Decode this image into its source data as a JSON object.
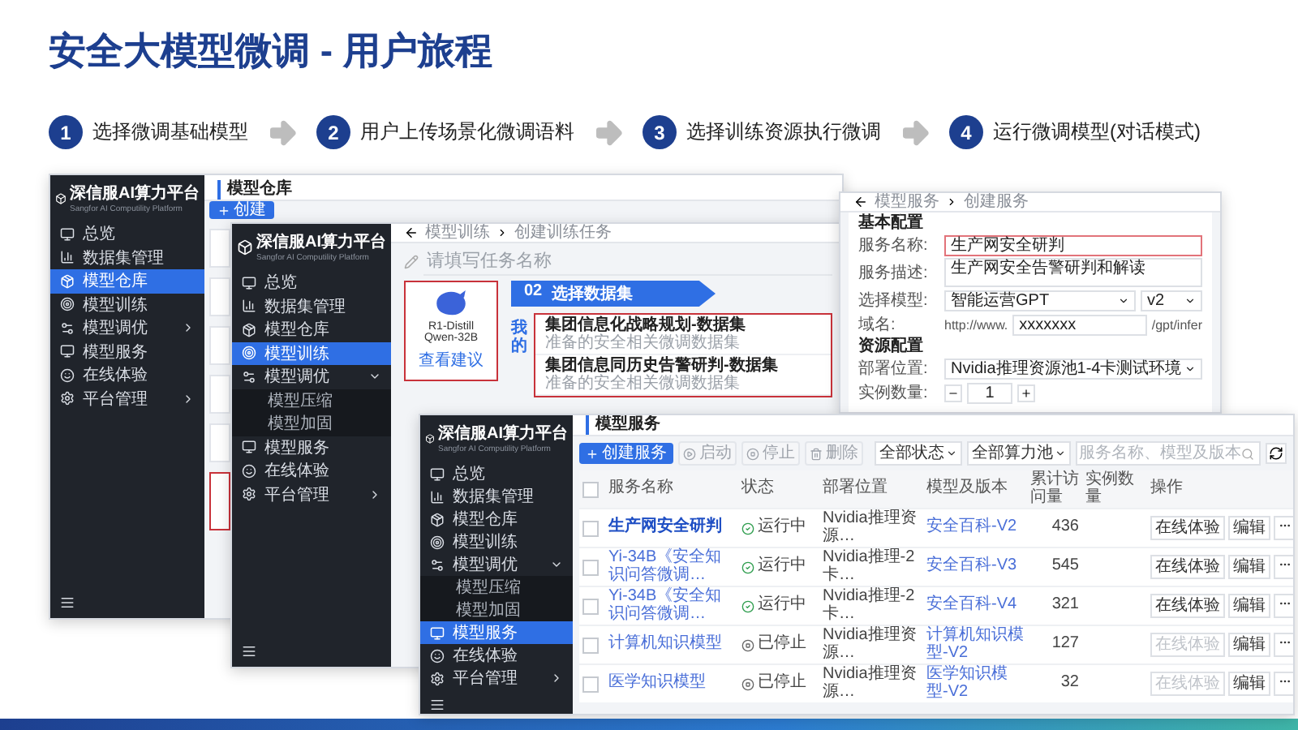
{
  "title": "安全大模型微调 - 用户旅程",
  "steps": [
    {
      "number": "1",
      "label": "选择微调基础模型"
    },
    {
      "number": "2",
      "label": "用户上传场景化微调语料"
    },
    {
      "number": "3",
      "label": "选择训练资源执行微调"
    },
    {
      "number": "4",
      "label": "运行微调模型(对话模式)"
    }
  ],
  "model_repo_window": {
    "sidebar": {
      "brand": "深信服AI算力平台",
      "subtitle": "Sangfor AI Computility Platform",
      "items": [
        {
          "kind": "link",
          "label": "总览",
          "selected": false
        },
        {
          "kind": "link",
          "label": "数据集管理",
          "selected": false
        },
        {
          "kind": "link",
          "label": "模型仓库",
          "selected": true
        },
        {
          "kind": "link",
          "label": "模型训练",
          "selected": false
        },
        {
          "kind": "group",
          "label": "模型调优",
          "selected": false,
          "expanded": false
        },
        {
          "kind": "link",
          "label": "模型服务",
          "selected": false
        },
        {
          "kind": "link",
          "label": "在线体验",
          "selected": false
        },
        {
          "kind": "group",
          "label": "平台管理",
          "selected": false,
          "expanded": false
        }
      ]
    },
    "page_title": "模型仓库",
    "create_button": "创建",
    "card_highlighted": true
  },
  "training_window": {
    "sidebar": {
      "brand": "深信服AI算力平台",
      "subtitle": "Sangfor AI Computility Platform",
      "items": [
        {
          "kind": "link",
          "label": "总览",
          "selected": false
        },
        {
          "kind": "link",
          "label": "数据集管理",
          "selected": false
        },
        {
          "kind": "link",
          "label": "模型仓库",
          "selected": false
        },
        {
          "kind": "link",
          "label": "模型训练",
          "selected": true
        },
        {
          "kind": "group",
          "label": "模型调优",
          "selected": false,
          "expanded": true,
          "children": [
            {
              "label": "模型压缩",
              "selected": false
            },
            {
              "label": "模型加固",
              "selected": false
            }
          ]
        },
        {
          "kind": "link",
          "label": "模型服务",
          "selected": false
        },
        {
          "kind": "link",
          "label": "在线体验",
          "selected": false
        },
        {
          "kind": "group",
          "label": "平台管理",
          "selected": false,
          "expanded": false
        }
      ]
    },
    "breadcrumb": [
      "模型训练",
      "创建训练任务"
    ],
    "task_name_placeholder": "请填写任务名称",
    "step_banner": {
      "number": "02",
      "label": "选择数据集"
    },
    "model_card": {
      "name": "R1-Distill Qwen-32B",
      "link": "查看建议",
      "highlighted": true
    },
    "dataset_tab": "我的",
    "datasets_highlighted": true,
    "datasets": [
      {
        "name": "集团信息化战略规划-数据集",
        "description": "准备的安全相关微调数据集"
      },
      {
        "name": "集团信息同历史告警研判-数据集",
        "description": "准备的安全相关微调数据集"
      }
    ]
  },
  "service_form_window": {
    "breadcrumb": [
      "模型服务",
      "创建服务"
    ],
    "sections": [
      {
        "title": "基本配置",
        "fields": [
          {
            "kind": "input",
            "label": "服务名称:",
            "value": "生产网安全研判",
            "highlighted": true
          },
          {
            "kind": "textarea",
            "label": "服务描述:",
            "value": "生产网安全告警研判和解读",
            "highlighted": false
          },
          {
            "kind": "select",
            "label": "选择模型:",
            "value": "智能运营GPT",
            "version": "v2",
            "highlighted": false
          },
          {
            "kind": "domain",
            "label": "域名:",
            "prefix": "http://www.",
            "value": "xxxxxxx",
            "suffix": "/gpt/infer",
            "highlighted": false
          }
        ]
      },
      {
        "title": "资源配置",
        "fields": [
          {
            "kind": "select",
            "label": "部署位置:",
            "value": "Nvidia推理资源池1-4卡测试环境",
            "highlighted": false
          },
          {
            "kind": "stepper",
            "label": "实例数量:",
            "value": "1",
            "highlighted": false
          }
        ]
      }
    ]
  },
  "services_window": {
    "sidebar": {
      "brand": "深信服AI算力平台",
      "subtitle": "Sangfor AI Computility Platform",
      "items": [
        {
          "kind": "link",
          "label": "总览",
          "selected": false
        },
        {
          "kind": "link",
          "label": "数据集管理",
          "selected": false
        },
        {
          "kind": "link",
          "label": "模型仓库",
          "selected": false
        },
        {
          "kind": "link",
          "label": "模型训练",
          "selected": false
        },
        {
          "kind": "group",
          "label": "模型调优",
          "selected": false,
          "expanded": true,
          "children": [
            {
              "label": "模型压缩",
              "selected": false
            },
            {
              "label": "模型加固",
              "selected": false
            }
          ]
        },
        {
          "kind": "link",
          "label": "模型服务",
          "selected": true
        },
        {
          "kind": "link",
          "label": "在线体验",
          "selected": false
        },
        {
          "kind": "group",
          "label": "平台管理",
          "selected": false,
          "expanded": false
        }
      ]
    },
    "page_title": "模型服务",
    "actions": [
      {
        "kind": "primary",
        "label": "创建服务"
      },
      {
        "kind": "start",
        "label": "启动"
      },
      {
        "kind": "stop",
        "label": "停止"
      },
      {
        "kind": "delete",
        "label": "删除"
      }
    ],
    "filters": [
      "全部状态",
      "全部算力池"
    ],
    "search_placeholder": "服务名称、模型及版本",
    "all_checked": false,
    "columns": [
      "服务名称",
      "状态",
      "部署位置",
      "模型及版本",
      "累计访问量",
      "实例数量",
      "操作"
    ],
    "rows": [
      {
        "checked": false,
        "name": "生产网安全研判",
        "emphasized": true,
        "status": "运行中",
        "running": true,
        "location": "Nvidia推理资源…",
        "model": "安全百科-V2",
        "visits": "436",
        "actions": [
          "在线体验",
          "编辑"
        ]
      },
      {
        "checked": false,
        "name": "Yi-34B《安全知识问答微调…",
        "emphasized": false,
        "status": "运行中",
        "running": true,
        "location": "Nvidia推理-2卡…",
        "model": "安全百科-V3",
        "visits": "545",
        "actions": [
          "在线体验",
          "编辑"
        ]
      },
      {
        "checked": false,
        "name": "Yi-34B《安全知识问答微调…",
        "emphasized": false,
        "status": "运行中",
        "running": true,
        "location": "Nvidia推理-2卡…",
        "model": "安全百科-V4",
        "visits": "321",
        "actions": [
          "在线体验",
          "编辑"
        ]
      },
      {
        "checked": false,
        "name": "计算机知识模型",
        "emphasized": false,
        "status": "已停止",
        "running": false,
        "location": "Nvidia推理资源…",
        "model": "计算机知识模型-V2",
        "visits": "127",
        "actions": [
          "在线体验",
          "编辑"
        ]
      },
      {
        "checked": false,
        "name": "医学知识模型",
        "emphasized": false,
        "status": "已停止",
        "running": false,
        "location": "Nvidia推理资源…",
        "model": "医学知识模型-V2",
        "visits": "32",
        "actions": [
          "在线体验",
          "编辑"
        ]
      }
    ]
  }
}
